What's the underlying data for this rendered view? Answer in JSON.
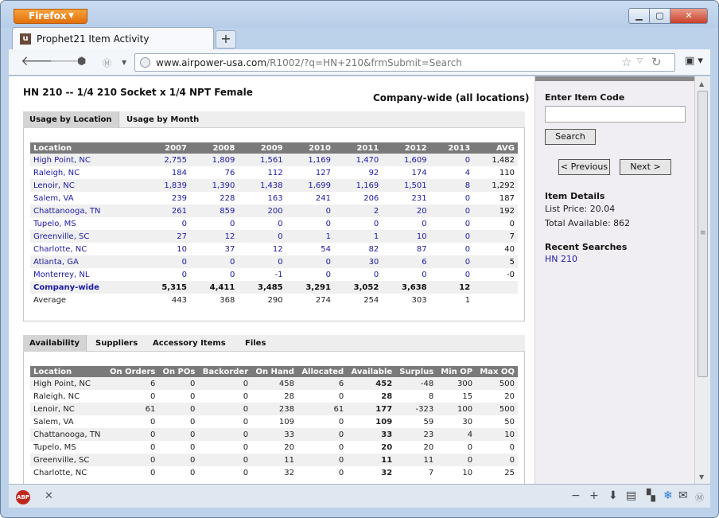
{
  "browser": {
    "menu_button": "Firefox",
    "tab_title": "Prophet21 Item Activity",
    "favicon_letter": "u",
    "url_domain": "www.airpower-usa.com",
    "url_path": "/R1002/?q=HN+210&frmSubmit=Search"
  },
  "page": {
    "item_title": "HN 210 -- 1/4 210 Socket x 1/4 NPT Female",
    "scope_label": "Company-wide (all locations)"
  },
  "usage_tabs": [
    "Usage by Location",
    "Usage by Month"
  ],
  "usage_table": {
    "headers": [
      "Location",
      "2007",
      "2008",
      "2009",
      "2010",
      "2011",
      "2012",
      "2013",
      "AVG"
    ],
    "rows": [
      [
        "High Point, NC",
        "2,755",
        "1,809",
        "1,561",
        "1,169",
        "1,470",
        "1,609",
        "0",
        "1,482"
      ],
      [
        "Raleigh, NC",
        "184",
        "76",
        "112",
        "127",
        "92",
        "174",
        "4",
        "110"
      ],
      [
        "Lenoir, NC",
        "1,839",
        "1,390",
        "1,438",
        "1,699",
        "1,169",
        "1,501",
        "8",
        "1,292"
      ],
      [
        "Salem, VA",
        "239",
        "228",
        "163",
        "241",
        "206",
        "231",
        "0",
        "187"
      ],
      [
        "Chattanooga, TN",
        "261",
        "859",
        "200",
        "0",
        "2",
        "20",
        "0",
        "192"
      ],
      [
        "Tupelo, MS",
        "0",
        "0",
        "0",
        "0",
        "0",
        "0",
        "0",
        "0"
      ],
      [
        "Greenville, SC",
        "27",
        "12",
        "0",
        "1",
        "1",
        "10",
        "0",
        "7"
      ],
      [
        "Charlotte, NC",
        "10",
        "37",
        "12",
        "54",
        "82",
        "87",
        "0",
        "40"
      ],
      [
        "Atlanta, GA",
        "0",
        "0",
        "0",
        "0",
        "30",
        "6",
        "0",
        "5"
      ],
      [
        "Monterrey, NL",
        "0",
        "0",
        "-1",
        "0",
        "0",
        "0",
        "0",
        "-0"
      ]
    ],
    "company_row": [
      "Company-wide",
      "5,315",
      "4,411",
      "3,485",
      "3,291",
      "3,052",
      "3,638",
      "12",
      ""
    ],
    "average_row": [
      "Average",
      "443",
      "368",
      "290",
      "274",
      "254",
      "303",
      "1",
      ""
    ]
  },
  "avail_tabs": [
    "Availability",
    "Suppliers",
    "Accessory Items",
    "Files"
  ],
  "avail_table": {
    "headers": [
      "Location",
      "On Orders",
      "On POs",
      "Backorder",
      "On Hand",
      "Allocated",
      "Available",
      "Surplus",
      "Min OP",
      "Max OQ"
    ],
    "rows": [
      [
        "High Point, NC",
        "6",
        "0",
        "0",
        "458",
        "6",
        "452",
        "-48",
        "300",
        "500"
      ],
      [
        "Raleigh, NC",
        "0",
        "0",
        "0",
        "28",
        "0",
        "28",
        "8",
        "15",
        "20"
      ],
      [
        "Lenoir, NC",
        "61",
        "0",
        "0",
        "238",
        "61",
        "177",
        "-323",
        "100",
        "500"
      ],
      [
        "Salem, VA",
        "0",
        "0",
        "0",
        "109",
        "0",
        "109",
        "59",
        "30",
        "50"
      ],
      [
        "Chattanooga, TN",
        "0",
        "0",
        "0",
        "33",
        "0",
        "33",
        "23",
        "4",
        "10"
      ],
      [
        "Tupelo, MS",
        "0",
        "0",
        "0",
        "20",
        "0",
        "20",
        "20",
        "0",
        "0"
      ],
      [
        "Greenville, SC",
        "0",
        "0",
        "0",
        "11",
        "0",
        "11",
        "11",
        "0",
        "0"
      ],
      [
        "Charlotte, NC",
        "0",
        "0",
        "0",
        "32",
        "0",
        "32",
        "7",
        "10",
        "25"
      ]
    ]
  },
  "sidebar": {
    "enter_label": "Enter Item Code",
    "search_value": "",
    "search_button": "Search",
    "prev_button": "< Previous",
    "next_button": "Next >",
    "details_heading": "Item Details",
    "list_price": "List Price: 20.04",
    "total_available": "Total Available: 862",
    "recent_heading": "Recent Searches",
    "recent_items": [
      "HN 210"
    ]
  },
  "status": {
    "abp_label": "ABP"
  }
}
